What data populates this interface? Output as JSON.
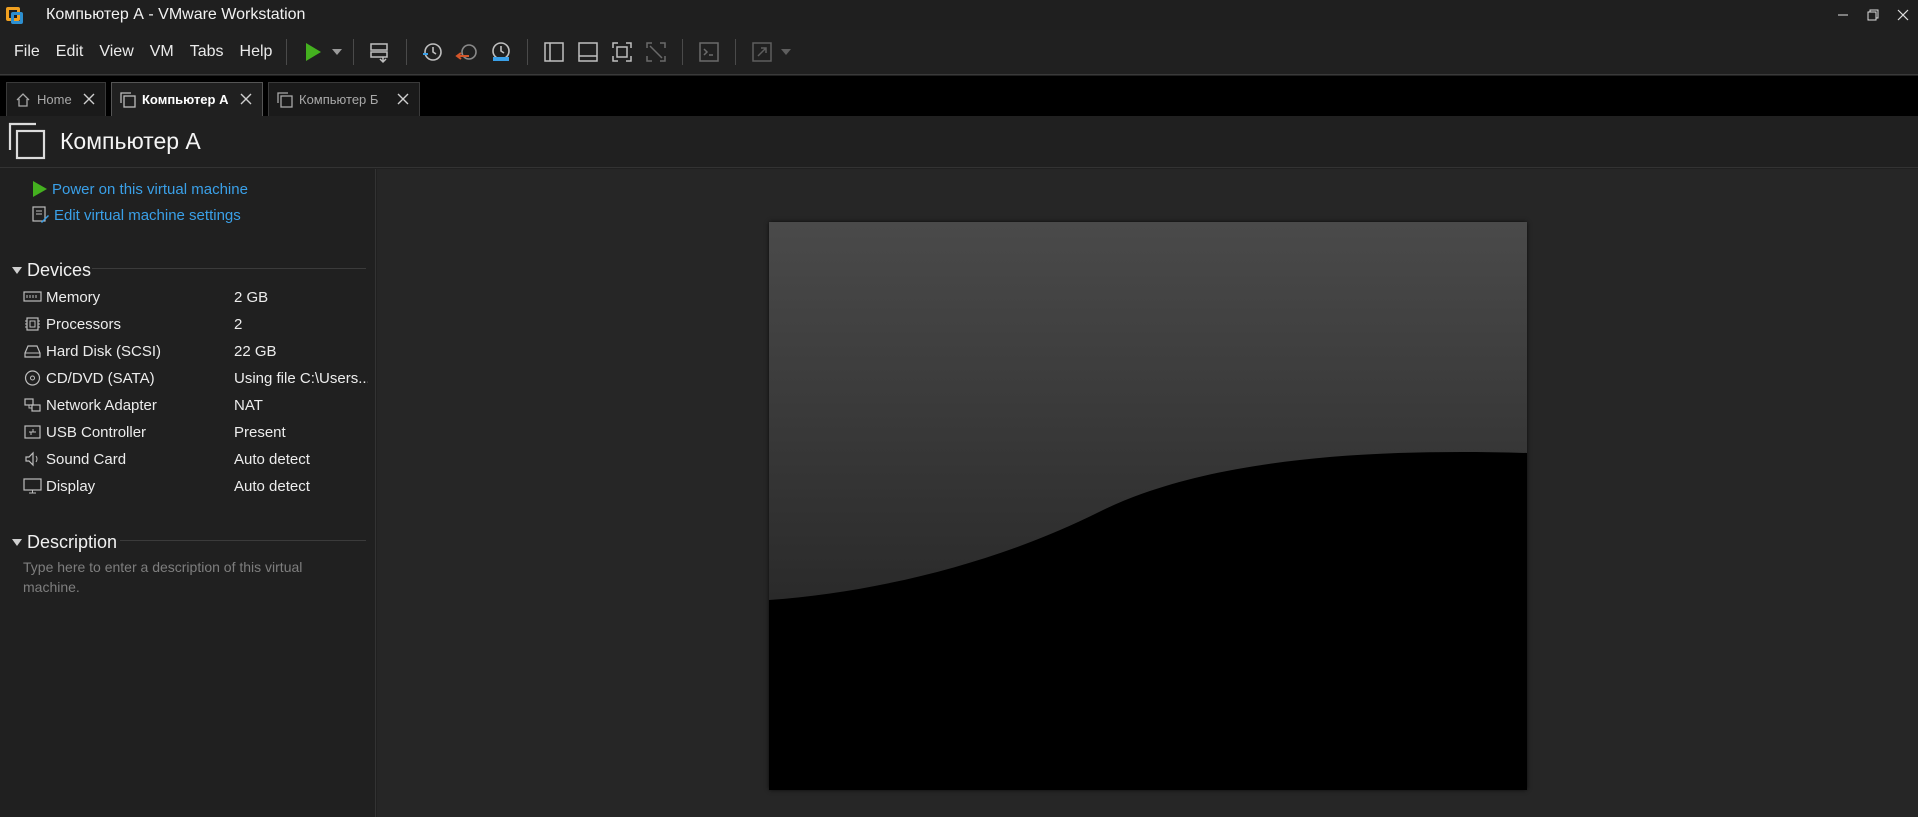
{
  "window": {
    "title": "Компьютер А - VMware Workstation",
    "app_icon": "vmware-logo-icon",
    "controls": [
      "minimize-icon",
      "restore-icon",
      "close-icon"
    ]
  },
  "menu": {
    "items": [
      "File",
      "Edit",
      "View",
      "VM",
      "Tabs",
      "Help"
    ]
  },
  "toolbar": {
    "icons": [
      "power-on-icon",
      "dropdown-arrow-icon",
      "send-ctrl-alt-del-icon",
      "snapshot-icon",
      "revert-snapshot-icon",
      "snapshot-manager-icon",
      "library-icon",
      "thumbnail-bar-icon",
      "full-screen-icon",
      "unity-icon",
      "console-view-icon",
      "stretch-guest-icon",
      "dropdown-arrow-icon"
    ]
  },
  "tabs": [
    {
      "label": "Home",
      "icon": "home-icon",
      "active": false
    },
    {
      "label": "Компьютер А",
      "icon": "vm-tab-icon",
      "active": true
    },
    {
      "label": "Компьютер Б",
      "icon": "vm-tab-icon",
      "active": false
    }
  ],
  "vm": {
    "name": "Компьютер А",
    "actions": [
      {
        "label": "Power on this virtual machine",
        "icon": "play-icon"
      },
      {
        "label": "Edit virtual machine settings",
        "icon": "edit-settings-icon"
      }
    ]
  },
  "devices": {
    "title": "Devices",
    "items": [
      {
        "name": "Memory",
        "value": "2 GB",
        "icon": "memory-icon"
      },
      {
        "name": "Processors",
        "value": "2",
        "icon": "processor-icon"
      },
      {
        "name": "Hard Disk (SCSI)",
        "value": "22 GB",
        "icon": "hard-disk-icon"
      },
      {
        "name": "CD/DVD (SATA)",
        "value": "Using file C:\\Users...",
        "icon": "cd-dvd-icon"
      },
      {
        "name": "Network Adapter",
        "value": "NAT",
        "icon": "network-adapter-icon"
      },
      {
        "name": "USB Controller",
        "value": "Present",
        "icon": "usb-icon"
      },
      {
        "name": "Sound Card",
        "value": "Auto detect",
        "icon": "sound-icon"
      },
      {
        "name": "Display",
        "value": "Auto detect",
        "icon": "display-icon"
      }
    ]
  },
  "description": {
    "title": "Description",
    "placeholder": "Type here to enter a description of this virtual machine."
  },
  "colors": {
    "accent_link": "#3aa0e8",
    "play_green": "#44b01f",
    "background": "#202020"
  }
}
